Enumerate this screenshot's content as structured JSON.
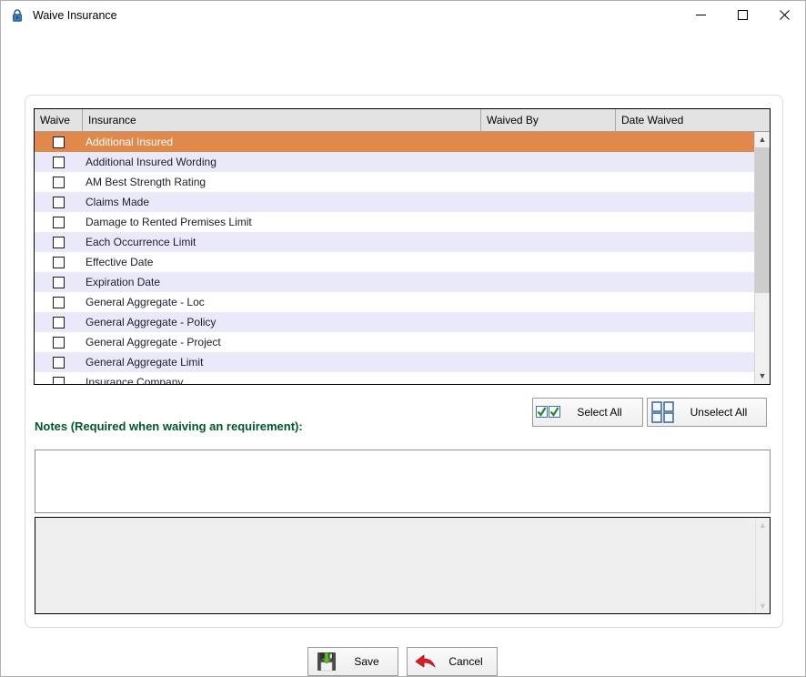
{
  "window": {
    "title": "Waive Insurance",
    "icon": "lock-icon",
    "controls": {
      "minimize": "—",
      "maximize": "☐",
      "close": "✕"
    }
  },
  "grid": {
    "columns": [
      "Waive",
      "Insurance",
      "Waived By",
      "Date Waived"
    ],
    "selected_index": 0,
    "rows": [
      {
        "waived": false,
        "insurance": "Additional Insured",
        "waived_by": "",
        "date_waived": ""
      },
      {
        "waived": false,
        "insurance": "Additional Insured Wording",
        "waived_by": "",
        "date_waived": ""
      },
      {
        "waived": false,
        "insurance": "AM Best Strength Rating",
        "waived_by": "",
        "date_waived": ""
      },
      {
        "waived": false,
        "insurance": "Claims Made",
        "waived_by": "",
        "date_waived": ""
      },
      {
        "waived": false,
        "insurance": "Damage to Rented Premises Limit",
        "waived_by": "",
        "date_waived": ""
      },
      {
        "waived": false,
        "insurance": "Each Occurrence Limit",
        "waived_by": "",
        "date_waived": ""
      },
      {
        "waived": false,
        "insurance": "Effective Date",
        "waived_by": "",
        "date_waived": ""
      },
      {
        "waived": false,
        "insurance": "Expiration Date",
        "waived_by": "",
        "date_waived": ""
      },
      {
        "waived": false,
        "insurance": "General Aggregate - Loc",
        "waived_by": "",
        "date_waived": ""
      },
      {
        "waived": false,
        "insurance": "General Aggregate - Policy",
        "waived_by": "",
        "date_waived": ""
      },
      {
        "waived": false,
        "insurance": "General Aggregate - Project",
        "waived_by": "",
        "date_waived": ""
      },
      {
        "waived": false,
        "insurance": "General Aggregate Limit",
        "waived_by": "",
        "date_waived": ""
      },
      {
        "waived": false,
        "insurance": "Insurance Company",
        "waived_by": "",
        "date_waived": ""
      }
    ],
    "scrollbar": {
      "up_arrow": "▲",
      "down_arrow": "▼",
      "thumb_size_percent": 66
    }
  },
  "toolbar": {
    "select_all_label": "Select All",
    "select_all_icon": "checked-boxes-icon",
    "unselect_all_label": "Unselect All",
    "unselect_all_icon": "empty-boxes-icon"
  },
  "notes": {
    "label": "Notes (Required when waiving an requirement):",
    "value": "",
    "placeholder": "",
    "history_value": "",
    "history_scroll": {
      "up_arrow": "▲",
      "down_arrow": "▼"
    }
  },
  "actions": {
    "save_label": "Save",
    "save_icon": "save-floppy-icon",
    "cancel_label": "Cancel",
    "cancel_icon": "red-back-arrow-icon"
  },
  "colors": {
    "selected_row": "#e0894b",
    "alt_row": "#e9e9fa",
    "notes_label": "#00572b",
    "header_bg": "#e3e3e3"
  }
}
